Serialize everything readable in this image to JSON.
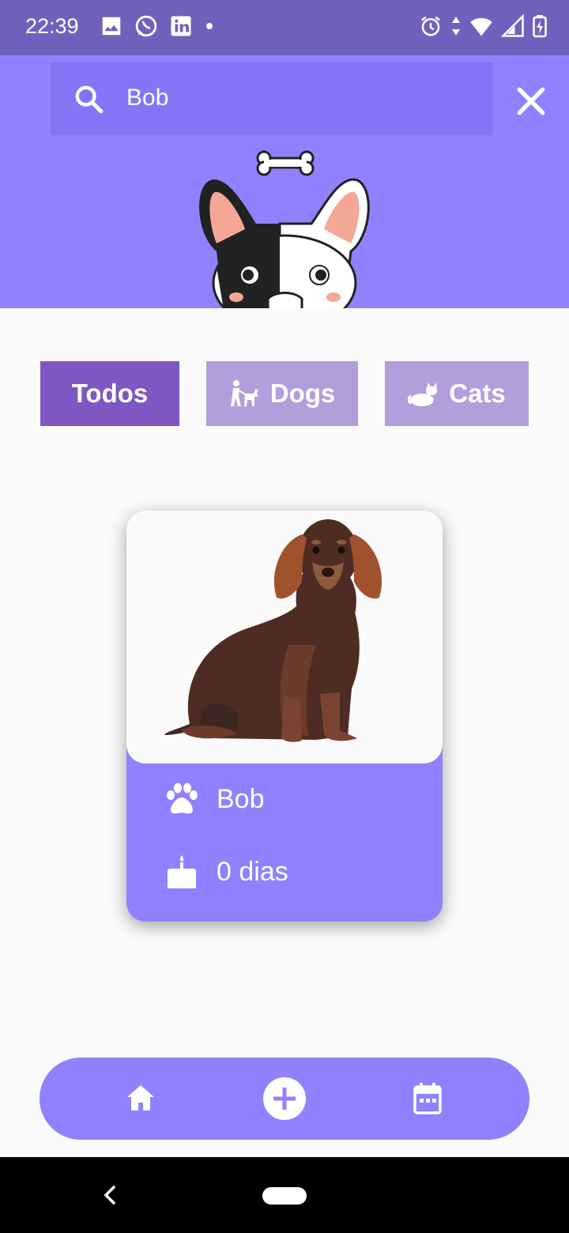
{
  "status_bar": {
    "time": "22:39",
    "left_icons": [
      "image-icon",
      "whatsapp-icon",
      "linkedin-icon",
      "notification-dot-icon"
    ],
    "right_icons": [
      "alarm-icon",
      "data-arrows-icon",
      "wifi-icon",
      "signal-icon",
      "battery-icon"
    ]
  },
  "search": {
    "value": "Bob",
    "search_icon": "search-icon",
    "close_icon": "close-icon"
  },
  "filters": [
    {
      "label": "Todos",
      "icon": "",
      "selected": true
    },
    {
      "label": "Dogs",
      "icon": "dog-walk-icon",
      "selected": false
    },
    {
      "label": "Cats",
      "icon": "cat-icon",
      "selected": false
    }
  ],
  "pet_card": {
    "name": "Bob",
    "age": "0 dias",
    "name_icon": "paw-icon",
    "age_icon": "cake-icon",
    "image": "dachshund-image"
  },
  "bottom_nav": {
    "items": [
      "home-icon",
      "add-circle-icon",
      "calendar-icon"
    ]
  },
  "colors": {
    "primary": "#9081ff",
    "status_bar": "#6f62bc",
    "selected_filter": "#7e57c2",
    "unselected_filter": "#b39ddb",
    "background": "#fafafa"
  }
}
